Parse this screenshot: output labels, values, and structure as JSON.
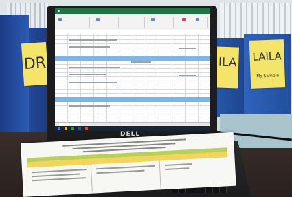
{
  "sticky_notes": {
    "left": "DR",
    "middle": "ILA",
    "right": "LAILA",
    "right_sub": "Ms Sample"
  },
  "laptop": {
    "brand": "DELL",
    "app_accent": "#217346",
    "highlight_row_color": "#7fb4e6"
  },
  "document": {
    "band_colors": [
      "#b8cf5a",
      "#f3d55c"
    ]
  }
}
